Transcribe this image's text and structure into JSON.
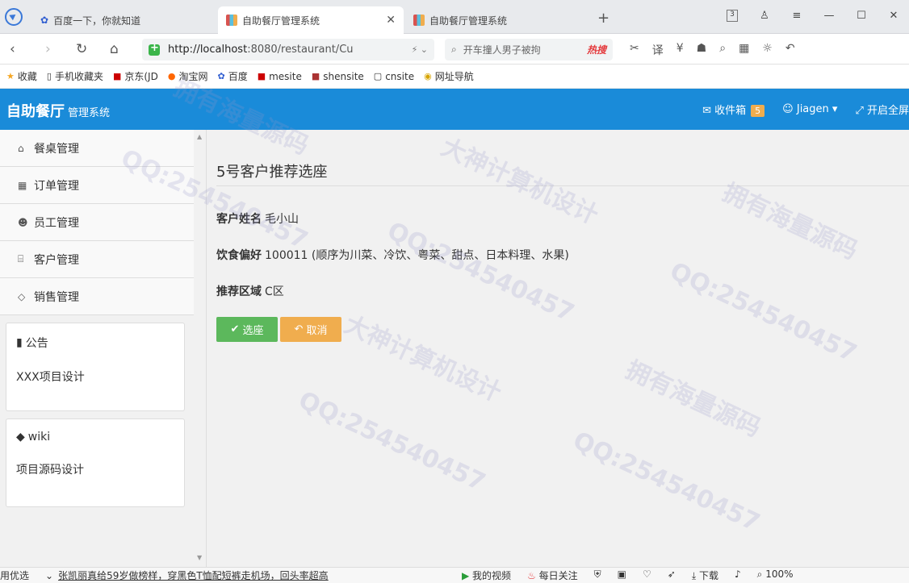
{
  "browser": {
    "tabs": [
      {
        "label": "百度一下，你就知道"
      },
      {
        "label": "自助餐厅管理系统"
      },
      {
        "label": "自助餐厅管理系统"
      }
    ],
    "tab_count": "3",
    "url_host": "http://localhost",
    "url_rest": ":8080/restaurant/Cu",
    "search_text": "开车撞人男子被拘",
    "hot_label": "热搜",
    "bookmarks": [
      "收藏",
      "手机收藏夹",
      "京东(JD",
      "淘宝网",
      "百度",
      "mesite",
      "shensite",
      "cnsite",
      "网址导航"
    ]
  },
  "app": {
    "brand": "自助餐厅",
    "brand_sub": "管理系统",
    "inbox_label": "收件箱",
    "inbox_count": "5",
    "user": "Jiagen",
    "fullscreen": "开启全屏"
  },
  "sidebar": {
    "items": [
      {
        "label": "餐桌管理",
        "icon": "home-icon"
      },
      {
        "label": "订单管理",
        "icon": "table-icon"
      },
      {
        "label": "员工管理",
        "icon": "users-icon"
      },
      {
        "label": "客户管理",
        "icon": "bank-icon"
      },
      {
        "label": "销售管理",
        "icon": "diamond-icon"
      }
    ],
    "notice_title": "公告",
    "notice_body": "XXX项目设计",
    "wiki_title": "wiki",
    "wiki_body": "项目源码设计"
  },
  "main": {
    "title": "5号客户推荐选座",
    "name_label": "客户姓名",
    "name_value": "毛小山",
    "pref_label": "饮食偏好",
    "pref_value": "100011 (顺序为川菜、冷饮、粤菜、甜点、日本料理、水果)",
    "area_label": "推荐区域",
    "area_value": "C区",
    "ok_button": "选座",
    "cancel_button": "取消"
  },
  "statusbar": {
    "left": "用优选",
    "news": "张凯丽真给59岁做榜样，穿黑色T恤配短裤走机场，回头率超高",
    "video": "我的视频",
    "daily": "每日关注",
    "download": "下载",
    "zoom": "100%"
  },
  "watermark": [
    "拥有海量源码",
    "QQ:254540457",
    "大神计算机设计"
  ]
}
